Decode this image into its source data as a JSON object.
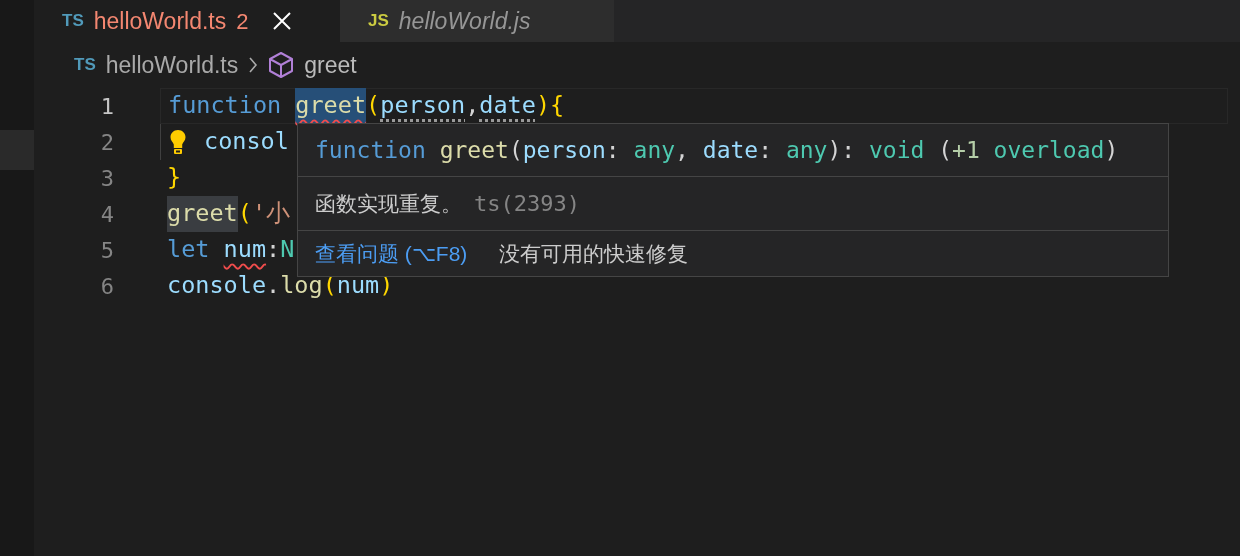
{
  "tabs": [
    {
      "icon": "TS",
      "color": "#519aba",
      "label": "helloWorld.ts",
      "badge": "2",
      "has_problems": true,
      "preview": false,
      "selected": true
    },
    {
      "icon": "JS",
      "color": "#cbcb41",
      "label": "helloWorld.js",
      "has_problems": false,
      "preview": true,
      "selected": false
    }
  ],
  "breadcrumb": {
    "file_icon": "TS",
    "file": "helloWorld.ts",
    "symbol": "greet"
  },
  "lines": [
    {
      "number": "1",
      "current": true,
      "lightbulb": false,
      "tokens": [
        {
          "text": "function",
          "kind": "keyword"
        },
        {
          "text": "greet",
          "kind": "function",
          "space_before": true,
          "selected_text": true,
          "squiggle": true
        },
        {
          "text": "(",
          "kind": "bracket"
        },
        {
          "text": "person",
          "kind": "variable",
          "hint_dots": true
        },
        {
          "text": ",",
          "kind": "punct"
        },
        {
          "text": "date",
          "kind": "variable",
          "hint_dots": true
        },
        {
          "text": ")",
          "kind": "bracket"
        },
        {
          "text": "{",
          "kind": "bracket"
        }
      ]
    },
    {
      "number": "2",
      "current": false,
      "lightbulb": true,
      "tokens": [
        {
          "text": "consol",
          "kind": "variable"
        }
      ]
    },
    {
      "number": "3",
      "current": false,
      "lightbulb": false,
      "tokens": [
        {
          "text": "}",
          "kind": "bracket"
        }
      ]
    },
    {
      "number": "4",
      "current": false,
      "lightbulb": false,
      "tokens": [
        {
          "text": "greet",
          "kind": "function",
          "occurrence": true
        },
        {
          "text": "(",
          "kind": "bracket"
        },
        {
          "text": "'小",
          "kind": "string"
        }
      ]
    },
    {
      "number": "5",
      "current": false,
      "lightbulb": false,
      "tokens": [
        {
          "text": "let",
          "kind": "keyword"
        },
        {
          "text": "num",
          "kind": "variable",
          "space_before": true,
          "squiggle": true
        },
        {
          "text": ":",
          "kind": "punct"
        },
        {
          "text": "N",
          "kind": "type"
        }
      ]
    },
    {
      "number": "6",
      "current": false,
      "lightbulb": false,
      "tokens": [
        {
          "text": "console",
          "kind": "variable"
        },
        {
          "text": ".",
          "kind": "punct"
        },
        {
          "text": "log",
          "kind": "function"
        },
        {
          "text": "(",
          "kind": "bracket"
        },
        {
          "text": "num",
          "kind": "variable"
        },
        {
          "text": ")",
          "kind": "bracket"
        }
      ]
    }
  ],
  "hover": {
    "signature": [
      {
        "text": "function",
        "kind": "keyword"
      },
      {
        "text": "greet",
        "kind": "function",
        "space_before": true
      },
      {
        "text": "(",
        "kind": "punct"
      },
      {
        "text": "person",
        "kind": "variable"
      },
      {
        "text": ": ",
        "kind": "punct"
      },
      {
        "text": "any",
        "kind": "type"
      },
      {
        "text": ", ",
        "kind": "punct"
      },
      {
        "text": "date",
        "kind": "variable"
      },
      {
        "text": ": ",
        "kind": "punct"
      },
      {
        "text": "any",
        "kind": "type"
      },
      {
        "text": "): ",
        "kind": "punct"
      },
      {
        "text": "void",
        "kind": "type"
      },
      {
        "text": " (",
        "kind": "punct"
      },
      {
        "text": "+1",
        "kind": "number"
      },
      {
        "text": "overload",
        "kind": "type",
        "space_before": true
      },
      {
        "text": ")",
        "kind": "punct"
      }
    ],
    "message": "函数实现重复。",
    "code": "ts(2393)",
    "action_link": "查看问题 (⌥F8)",
    "action_note": "没有可用的快速修复"
  }
}
